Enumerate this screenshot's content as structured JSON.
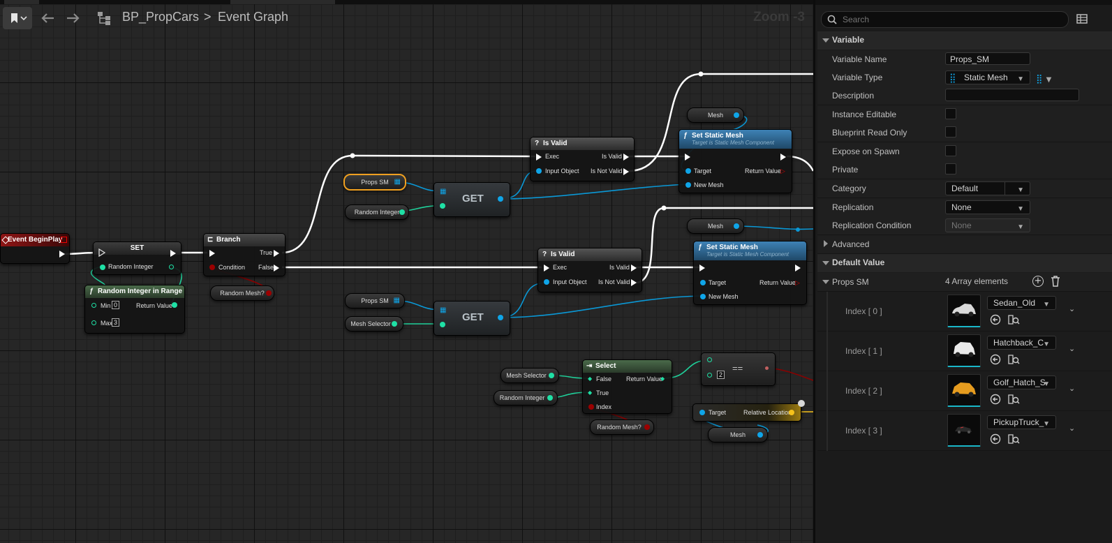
{
  "toolbar": {
    "breadcrumb_asset": "BP_PropCars",
    "breadcrumb_separator": ">",
    "breadcrumb_graph": "Event Graph",
    "zoom": "Zoom -3"
  },
  "nodes": {
    "event_begin_play": {
      "title": "Event BeginPlay"
    },
    "set": {
      "title": "SET",
      "pin_random_integer": "Random Integer"
    },
    "random_int_range": {
      "title": "Random Integer in Range",
      "pin_min": "Min",
      "min_value": "0",
      "pin_max": "Max",
      "max_value": "3",
      "pin_return": "Return Value"
    },
    "branch": {
      "title": "Branch",
      "pin_true": "True",
      "pin_false": "False",
      "pin_condition": "Condition"
    },
    "random_mesh_var_1": {
      "label": "Random Mesh?"
    },
    "random_mesh_var_2": {
      "label": "Random Mesh?"
    },
    "props_sm_var_1": {
      "label": "Props SM"
    },
    "props_sm_var_2": {
      "label": "Props SM"
    },
    "random_integer_var_1": {
      "label": "Random Integer"
    },
    "random_integer_var_2": {
      "label": "Random Integer"
    },
    "mesh_selector_var_1": {
      "label": "Mesh Selector"
    },
    "mesh_selector_var_2": {
      "label": "Mesh Selector"
    },
    "get_1": {
      "label": "GET"
    },
    "get_2": {
      "label": "GET"
    },
    "is_valid_1": {
      "title": "Is Valid",
      "pin_exec": "Exec",
      "pin_input": "Input Object",
      "pin_is_valid": "Is Valid",
      "pin_not_valid": "Is Not Valid"
    },
    "is_valid_2": {
      "title": "Is Valid",
      "pin_exec": "Exec",
      "pin_input": "Input Object",
      "pin_is_valid": "Is Valid",
      "pin_not_valid": "Is Not Valid"
    },
    "set_static_mesh_1": {
      "title": "Set Static Mesh",
      "subtitle": "Target is Static Mesh Component",
      "pin_target": "Target",
      "pin_new_mesh": "New Mesh",
      "pin_return": "Return Value"
    },
    "set_static_mesh_2": {
      "title": "Set Static Mesh",
      "subtitle": "Target is Static Mesh Component",
      "pin_target": "Target",
      "pin_new_mesh": "New Mesh",
      "pin_return": "Return Value"
    },
    "mesh_var_1": {
      "label": "Mesh"
    },
    "mesh_var_2": {
      "label": "Mesh"
    },
    "mesh_var_3": {
      "label": "Mesh"
    },
    "select": {
      "title": "Select",
      "pin_false": "False",
      "pin_true": "True",
      "pin_index": "Index",
      "pin_return": "Return Value"
    },
    "equals": {
      "label": "==",
      "value": "2"
    },
    "relative_location": {
      "pin_target": "Target",
      "pin_output": "Relative Location"
    }
  },
  "details": {
    "search_placeholder": "Search",
    "section_variable": "Variable",
    "rows": {
      "variable_name_label": "Variable Name",
      "variable_name_value": "Props_SM",
      "variable_type_label": "Variable Type",
      "variable_type_value": "Static Mesh",
      "description_label": "Description",
      "instance_editable_label": "Instance Editable",
      "blueprint_read_only_label": "Blueprint Read Only",
      "expose_on_spawn_label": "Expose on Spawn",
      "private_label": "Private",
      "category_label": "Category",
      "category_value": "Default",
      "replication_label": "Replication",
      "replication_value": "None",
      "replication_condition_label": "Replication Condition",
      "replication_condition_value": "None"
    },
    "advanced_label": "Advanced",
    "section_default_value": "Default Value",
    "props_sm_label": "Props SM",
    "array_count": "4 Array elements",
    "elements": [
      {
        "index": "Index [ 0 ]",
        "asset": "Sedan_Old"
      },
      {
        "index": "Index [ 1 ]",
        "asset": "Hatchback_C"
      },
      {
        "index": "Index [ 2 ]",
        "asset": "Golf_Hatch_S"
      },
      {
        "index": "Index [ 3 ]",
        "asset": "PickupTruck_"
      }
    ]
  },
  "colors": {
    "exec": "#ffffff",
    "integer": "#1fe0a5",
    "object": "#0fa5e8",
    "boolean": "#9b0000",
    "vector": "#f6c21b",
    "function_header": "#2b6fa0",
    "pure_header": "#5f5f5f"
  }
}
